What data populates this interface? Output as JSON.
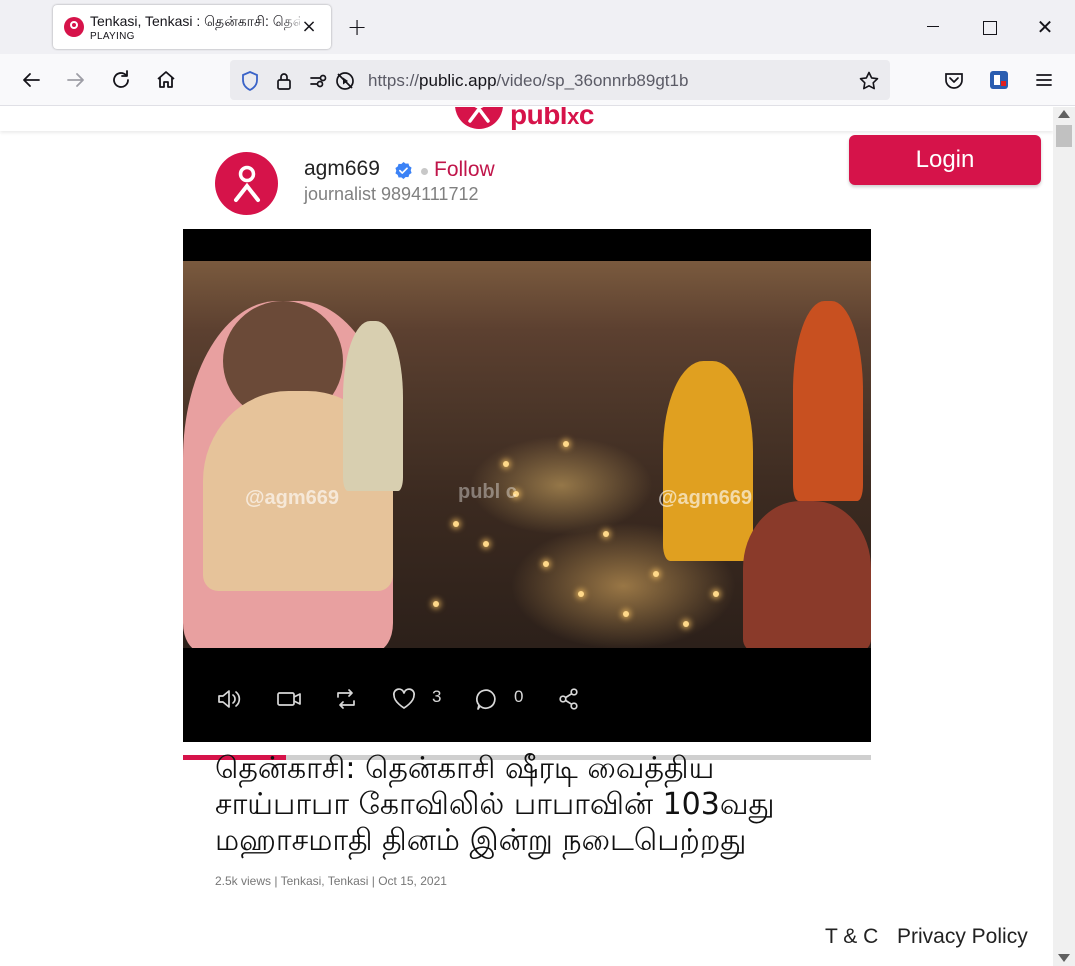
{
  "browser": {
    "tab": {
      "title": "Tenkasi, Tenkasi : தென்காசி: தென்காசி",
      "status": "PLAYING",
      "close_glyph": "×"
    },
    "new_tab_glyph": "+",
    "window_close_glyph": "✕",
    "url": {
      "prefix": "https://",
      "domain": "public.app",
      "path": "/video/sp_36onnrb89gt1b"
    }
  },
  "site": {
    "brand": "publ",
    "brand_suffix": "c",
    "login_label": "Login"
  },
  "author": {
    "username": "agm669",
    "follow_label": "Follow",
    "subtitle": "journalist 9894111712"
  },
  "video": {
    "watermark_left": "@agm669",
    "watermark_center": "publ c",
    "watermark_right": "@agm669",
    "progress_fraction": 0.15,
    "likes": "3",
    "comments": "0"
  },
  "post": {
    "title": "தென்காசி: தென்காசி ஷீரடி வைத்திய சாய்பாபா கோவிலில் பாபாவின் 103வது மஹாசமாதி தினம் இன்று நடைபெற்றது",
    "meta": "2.5k views | Tenkasi, Tenkasi | Oct 15, 2021"
  },
  "footer": {
    "terms": "T & C",
    "privacy": "Privacy Policy"
  },
  "colors": {
    "brand": "#d6134a",
    "verified": "#3b82f6"
  },
  "icons": [
    "back-icon",
    "forward-icon",
    "reload-icon",
    "home-icon",
    "shield-icon",
    "lock-icon",
    "permissions-icon",
    "autoplay-blocked-icon",
    "star-icon",
    "pocket-icon",
    "extension-icon",
    "menu-icon",
    "volume-icon",
    "camera-icon",
    "repost-icon",
    "heart-icon",
    "comment-icon",
    "share-icon",
    "verified-icon"
  ]
}
